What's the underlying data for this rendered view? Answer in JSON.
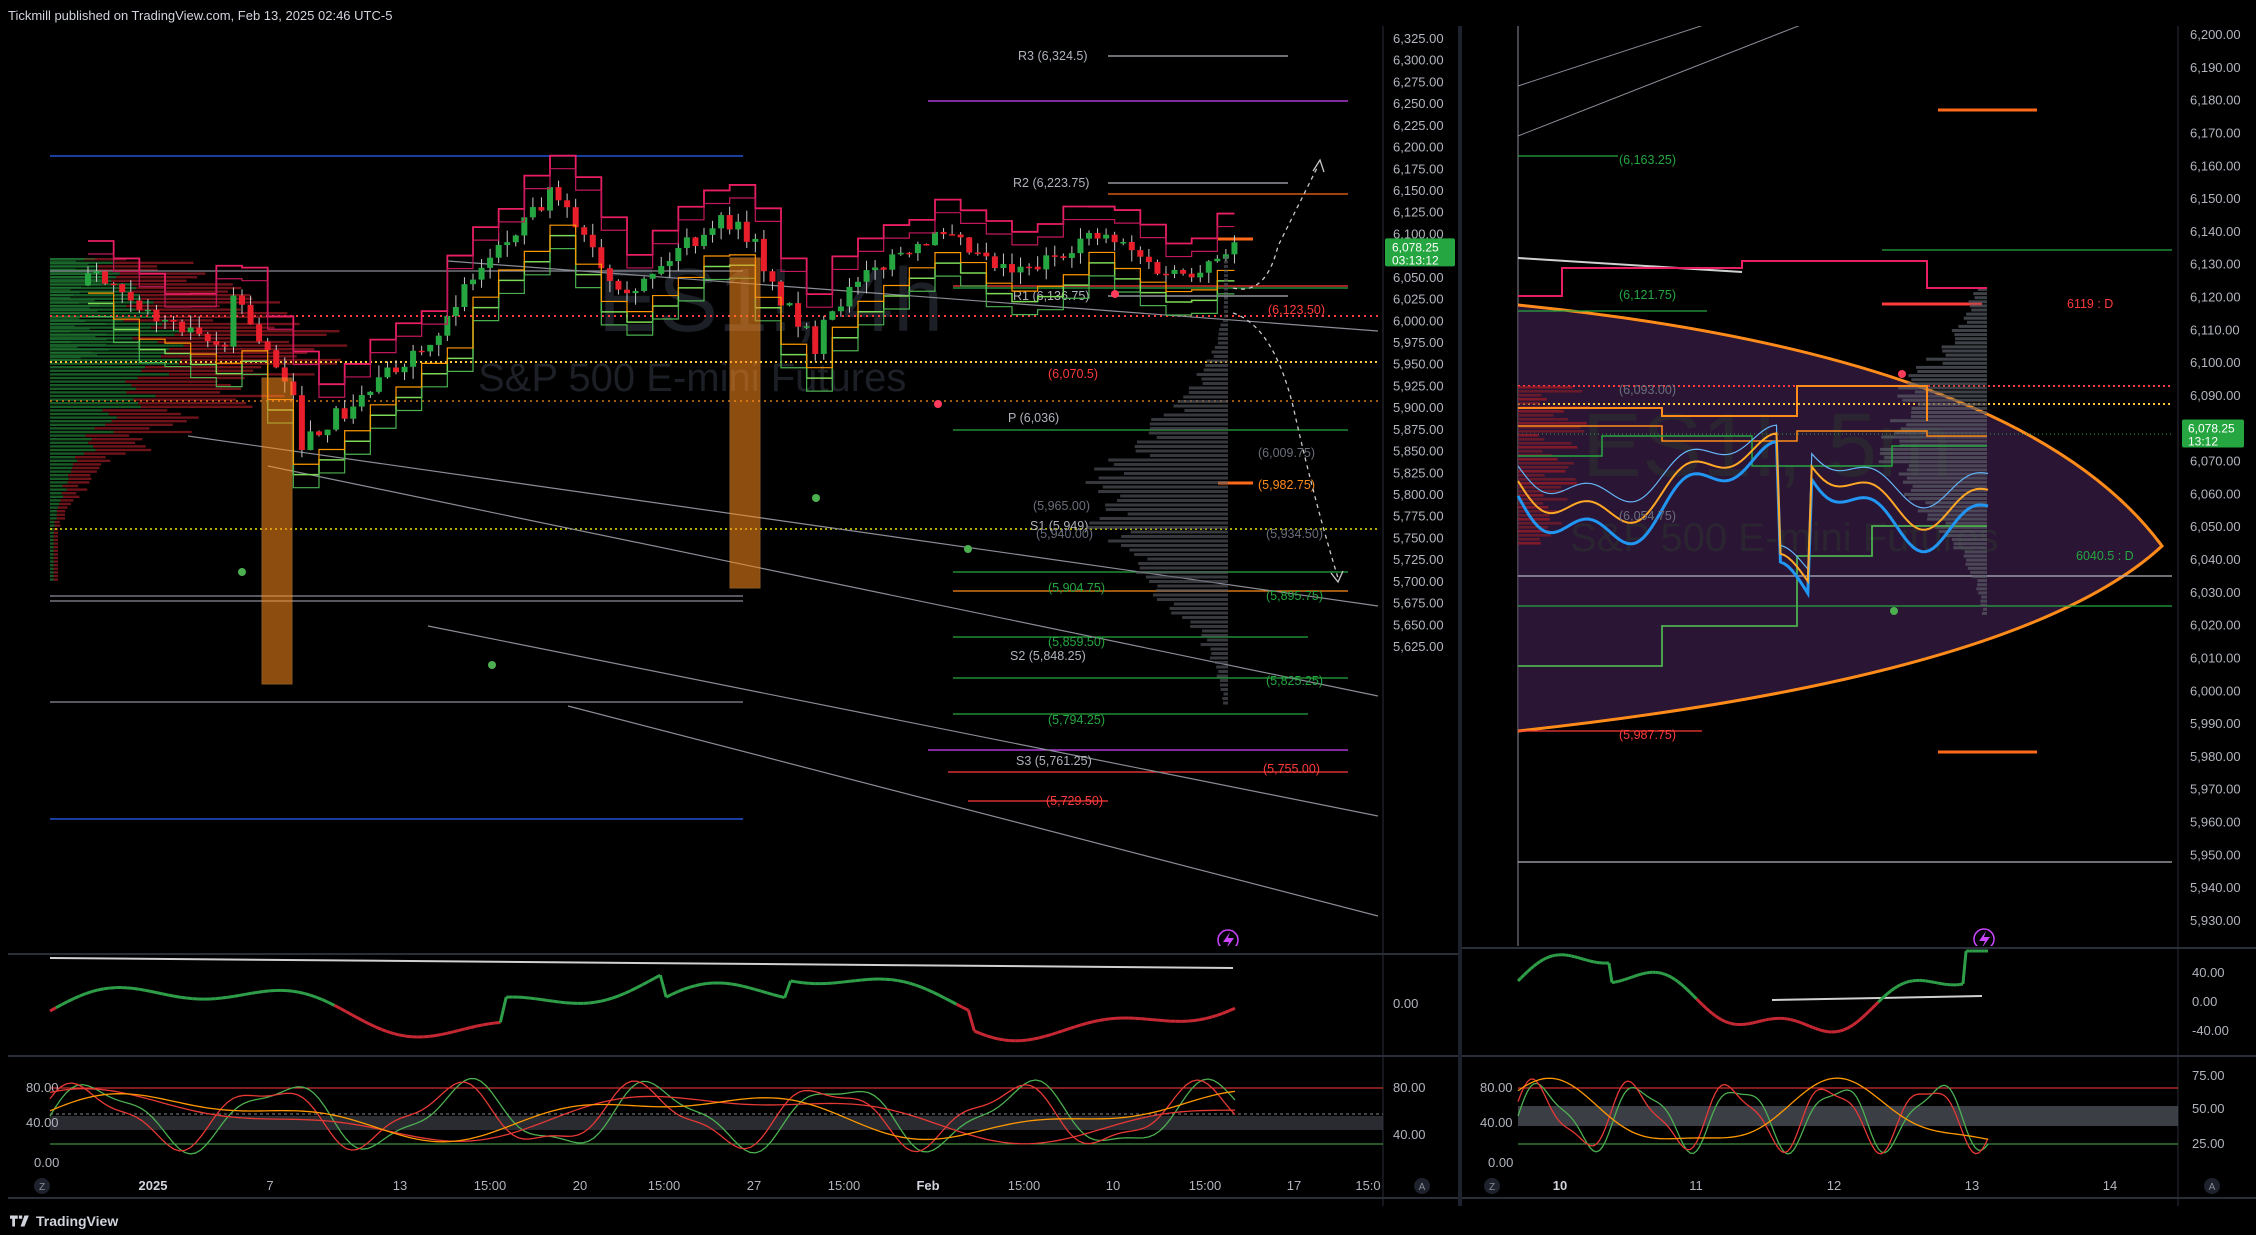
{
  "header": {
    "published": "Tickmill published on TradingView.com, Feb 13, 2025 02:46 UTC-5"
  },
  "footer": {
    "brand": "TradingView"
  },
  "colors": {
    "bull": "#26a641",
    "bear": "#e91e2b",
    "orange": "#ff8c1a",
    "pink": "#e91e63",
    "purple": "#cc44ff",
    "blue": "#2962ff",
    "green_tag": "#26a641"
  },
  "left_chart": {
    "watermark_symbol": "ES1!, 4h",
    "watermark_name": "S&P 500 E-mini Futures",
    "price_axis": [
      "6,325.00",
      "6,300.00",
      "6,275.00",
      "6,250.00",
      "6,225.00",
      "6,200.00",
      "6,175.00",
      "6,150.00",
      "6,125.00",
      "6,100.00",
      "6,050.00",
      "6,025.00",
      "6,000.00",
      "5,975.00",
      "5,950.00",
      "5,925.00",
      "5,900.00",
      "5,875.00",
      "5,850.00",
      "5,825.00",
      "5,800.00",
      "5,775.00",
      "5,750.00",
      "5,725.00",
      "5,700.00",
      "5,675.00",
      "5,650.00",
      "5,625.00"
    ],
    "last_price": "6,078.25",
    "countdown": "03:13:12",
    "time_axis": [
      "2025",
      "7",
      "13",
      "15:00",
      "20",
      "15:00",
      "27",
      "15:00",
      "Feb",
      "15:00",
      "10",
      "15:00",
      "17",
      "15:0"
    ],
    "levels": [
      {
        "label": "R3 (6,324.5)",
        "color": "#b0b3bd"
      },
      {
        "label": "R2 (6,223.75)",
        "color": "#b0b3bd"
      },
      {
        "label": "R1 (6,136.75)",
        "color": "#b0b3bd"
      },
      {
        "label": "(6,123.50)",
        "color": "#ff3b3b"
      },
      {
        "label": "(6,070.5)",
        "color": "#ff3b3b"
      },
      {
        "label": "P (6,036)",
        "color": "#b0b3bd"
      },
      {
        "label": "(6,009.75)",
        "color": "#6b6f7a"
      },
      {
        "label": "(5,982.75)",
        "color": "#ff8c1a"
      },
      {
        "label": "(5,965.00)",
        "color": "#6b6f7a"
      },
      {
        "label": "S1 (5,949)",
        "color": "#b0b3bd"
      },
      {
        "label": "(5,940.00)",
        "color": "#6b6f7a"
      },
      {
        "label": "(5,934.50)",
        "color": "#6b6f7a"
      },
      {
        "label": "(5,904.75)",
        "color": "#26a641"
      },
      {
        "label": "(5,895.75)",
        "color": "#26a641"
      },
      {
        "label": "(5,859.50)",
        "color": "#26a641"
      },
      {
        "label": "S2 (5,848.25)",
        "color": "#b0b3bd"
      },
      {
        "label": "(5,825.25)",
        "color": "#26a641"
      },
      {
        "label": "(5,794.25)",
        "color": "#26a641"
      },
      {
        "label": "S3 (5,761.25)",
        "color": "#b0b3bd"
      },
      {
        "label": "(5,755.00)",
        "color": "#ff3b3b"
      },
      {
        "label": "(5,729.50)",
        "color": "#ff3b3b"
      }
    ],
    "osc1_axis": [
      "0.00"
    ],
    "osc2_axis_left": [
      "80.00",
      "40.00",
      "0.00"
    ],
    "osc2_axis_right": [
      "80.00",
      "40.00"
    ]
  },
  "right_chart": {
    "watermark_symbol": "ES1!, 5m",
    "watermark_name": "S&P 500 E-mini Futures",
    "price_axis": [
      "6,200.00",
      "6,190.00",
      "6,180.00",
      "6,170.00",
      "6,160.00",
      "6,150.00",
      "6,140.00",
      "6,130.00",
      "6,120.00",
      "6,110.00",
      "6,100.00",
      "6,090.00",
      "6,070.00",
      "6,060.00",
      "6,050.00",
      "6,040.00",
      "6,030.00",
      "6,020.00",
      "6,010.00",
      "6,000.00",
      "5,990.00",
      "5,980.00",
      "5,970.00",
      "5,960.00",
      "5,950.00",
      "5,940.00",
      "5,930.00"
    ],
    "last_price": "6,078.25",
    "countdown": "13:12",
    "time_axis": [
      "10",
      "11",
      "12",
      "13",
      "14"
    ],
    "levels": [
      {
        "label": "(6,163.25)",
        "color": "#26a641"
      },
      {
        "label": "(6,121.75)",
        "color": "#26a641"
      },
      {
        "label": "6119 : D",
        "color": "#ff3b3b"
      },
      {
        "label": "(6,093.00)",
        "color": "#6b6f7a"
      },
      {
        "label": "(6,054.75)",
        "color": "#6b6f7a"
      },
      {
        "label": "6040.5 : D",
        "color": "#26a641"
      },
      {
        "label": "(5,987.75)",
        "color": "#ff3b3b"
      }
    ],
    "osc1_axis": [
      "40.00",
      "0.00",
      "-40.00"
    ],
    "osc2_axis_left": [
      "80.00",
      "40.00",
      "0.00"
    ],
    "osc2_axis_right": [
      "75.00",
      "50.00",
      "25.00"
    ]
  }
}
